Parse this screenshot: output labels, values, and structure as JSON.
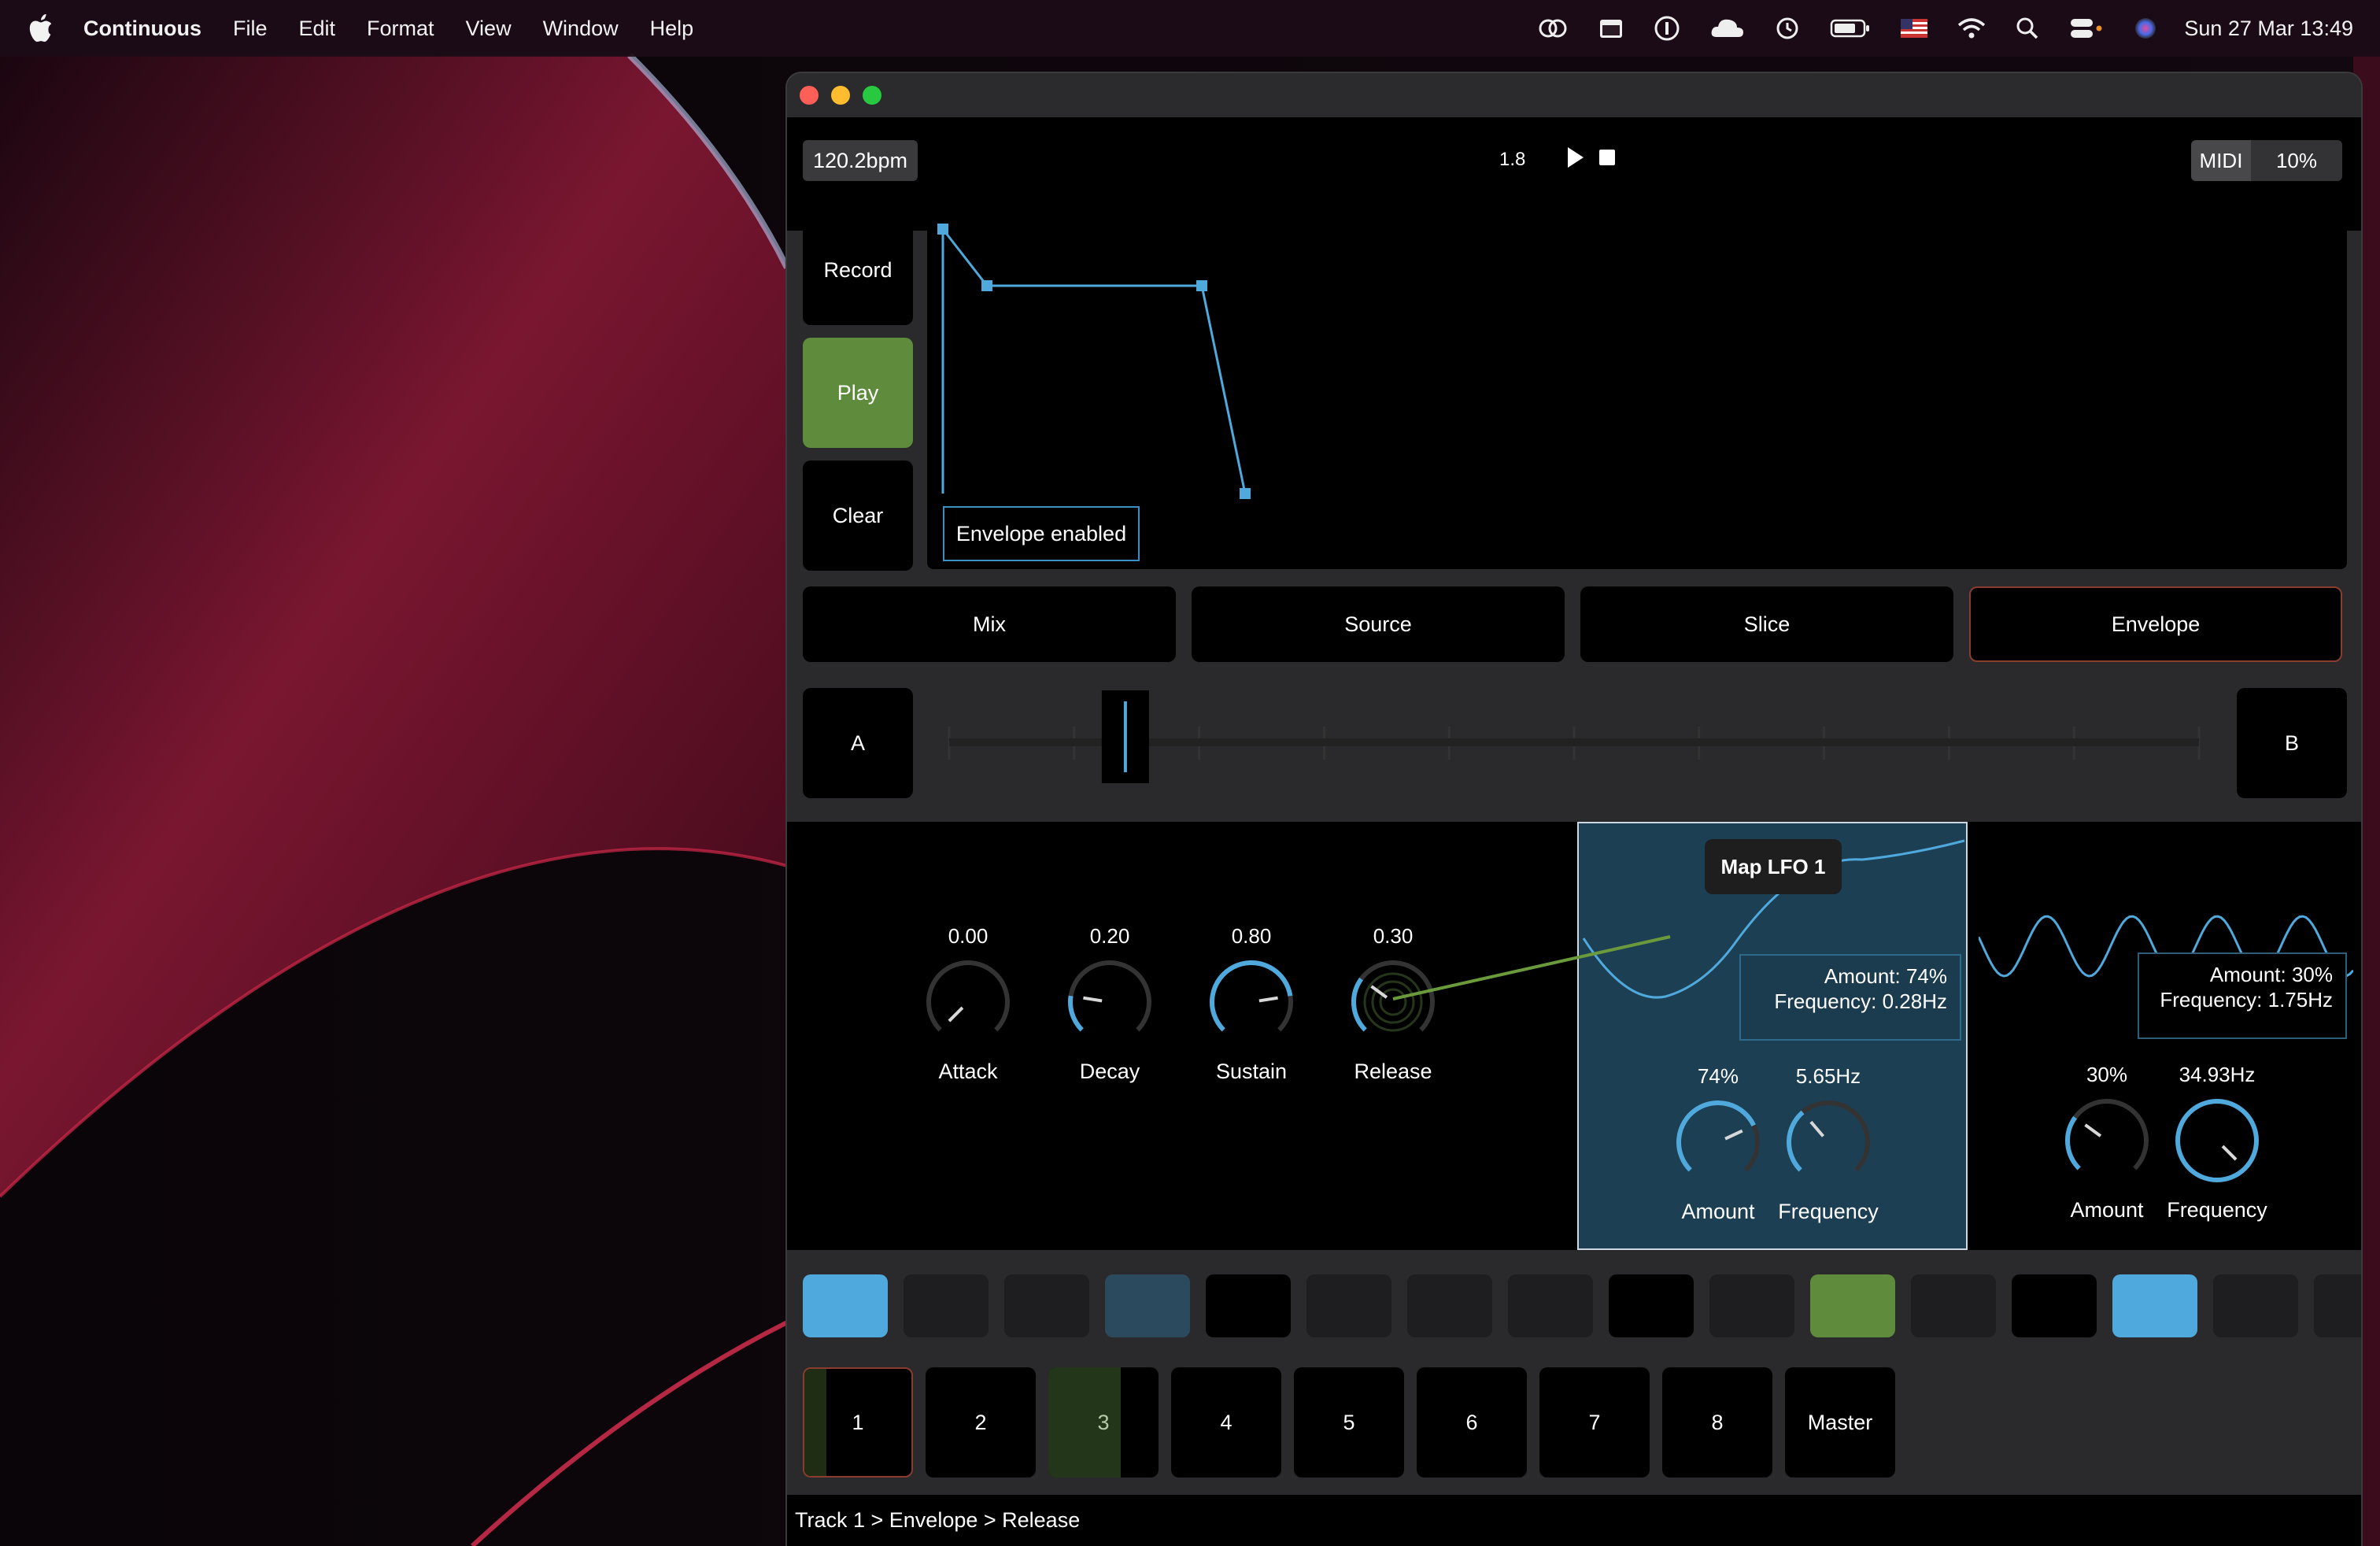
{
  "menubar": {
    "app": "Continuous",
    "items": [
      "File",
      "Edit",
      "Format",
      "View",
      "Window",
      "Help"
    ],
    "clock": "Sun 27 Mar  13:49",
    "icons": [
      "creative-cloud-icon",
      "calendar-icon",
      "info-icon",
      "cloud-icon",
      "time-machine-icon",
      "battery-icon",
      "flag-icon",
      "wifi-icon",
      "search-icon",
      "control-center-icon",
      "siri-icon"
    ]
  },
  "toolbar": {
    "bpm": "120.2bpm",
    "position": "1.8",
    "midi": "MIDI",
    "percent": "10%"
  },
  "sidebar": {
    "record": "Record",
    "play": "Play",
    "clear": "Clear"
  },
  "envelope": {
    "status": "Envelope enabled"
  },
  "tabs": [
    "Mix",
    "Source",
    "Slice",
    "Envelope"
  ],
  "crossfader": {
    "a": "A",
    "b": "B",
    "value": 0.141
  },
  "knobs": {
    "attack": {
      "value": "0.00",
      "label": "Attack",
      "level": 0.0
    },
    "decay": {
      "value": "0.20",
      "label": "Decay",
      "level": 0.2
    },
    "sustain": {
      "value": "0.80",
      "label": "Sustain",
      "level": 0.8
    },
    "release": {
      "value": "0.30",
      "label": "Release",
      "level": 0.3
    }
  },
  "lfo1": {
    "badge": "Map LFO 1",
    "readout_amount": "Amount: 74%",
    "readout_freq": "Frequency: 0.28Hz",
    "amount": {
      "value": "74%",
      "label": "Amount",
      "level": 0.74
    },
    "frequency": {
      "value": "5.65Hz",
      "label": "Frequency",
      "level": 0.35
    }
  },
  "lfo2": {
    "readout_amount": "Amount: 30%",
    "readout_freq": "Frequency: 1.75Hz",
    "amount": {
      "value": "30%",
      "label": "Amount",
      "level": 0.3
    },
    "frequency": {
      "value": "34.93Hz",
      "label": "Frequency",
      "level": 1.0
    }
  },
  "pads": [
    "blue",
    "dark",
    "dark",
    "steel",
    "black",
    "dark",
    "dark",
    "dark",
    "black",
    "dark",
    "green",
    "dark",
    "black",
    "blue",
    "dark",
    "dark"
  ],
  "colors": {
    "blue": "#4fa9dd",
    "dark": "#1e1e20",
    "steel": "#2c4a5e",
    "black": "#000000",
    "green": "#5f8c3c",
    "accent": "#4fa9dd",
    "active_border": "#8a3d2e"
  },
  "tracks": [
    "1",
    "2",
    "3",
    "4",
    "5",
    "6",
    "7",
    "8",
    "Master"
  ],
  "status": "Track 1 > Envelope > Release"
}
